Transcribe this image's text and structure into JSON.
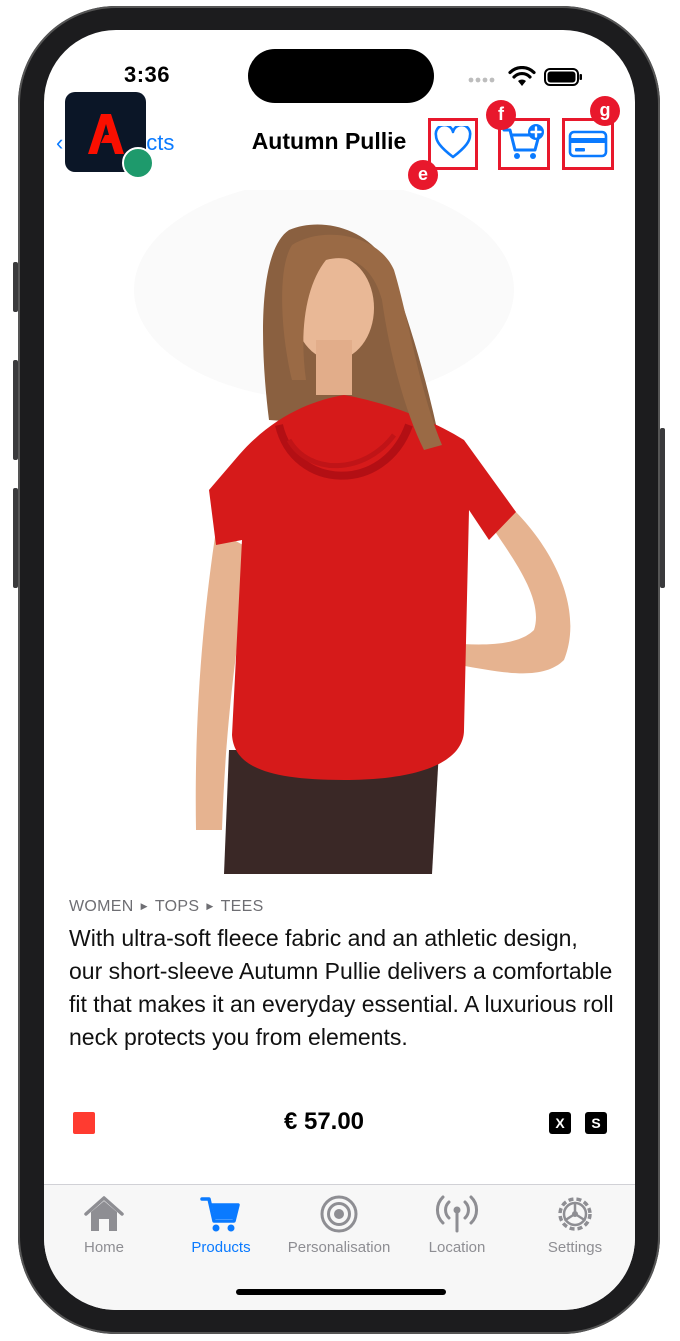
{
  "status_bar": {
    "time": "3:36"
  },
  "navbar": {
    "back_label": "Products",
    "back_visible_label": "ucts",
    "title": "Autumn Pullie"
  },
  "annotations": {
    "favorite": "e",
    "add_to_cart": "f",
    "checkout": "g"
  },
  "product": {
    "breadcrumb": [
      "WOMEN",
      "TOPS",
      "TEES"
    ],
    "description": "With ultra-soft fleece fabric and an athletic design, our short-sleeve Autumn Pullie delivers a comfortable fit that makes it an everyday essential. A luxurious roll neck protects you from elements.",
    "price": "€ 57.00",
    "color": "#ff3b30",
    "sizes": [
      "X",
      "S"
    ]
  },
  "tabbar": {
    "items": [
      {
        "label": "Home",
        "icon": "house-icon",
        "active": false
      },
      {
        "label": "Products",
        "icon": "cart-icon",
        "active": true
      },
      {
        "label": "Personalisation",
        "icon": "target-icon",
        "active": false
      },
      {
        "label": "Location",
        "icon": "antenna-icon",
        "active": false
      },
      {
        "label": "Settings",
        "icon": "gear-icon",
        "active": false
      }
    ]
  },
  "colors": {
    "accent": "#0a7aff",
    "highlight": "#e8182c",
    "brand_logo": "#fa0f00"
  }
}
